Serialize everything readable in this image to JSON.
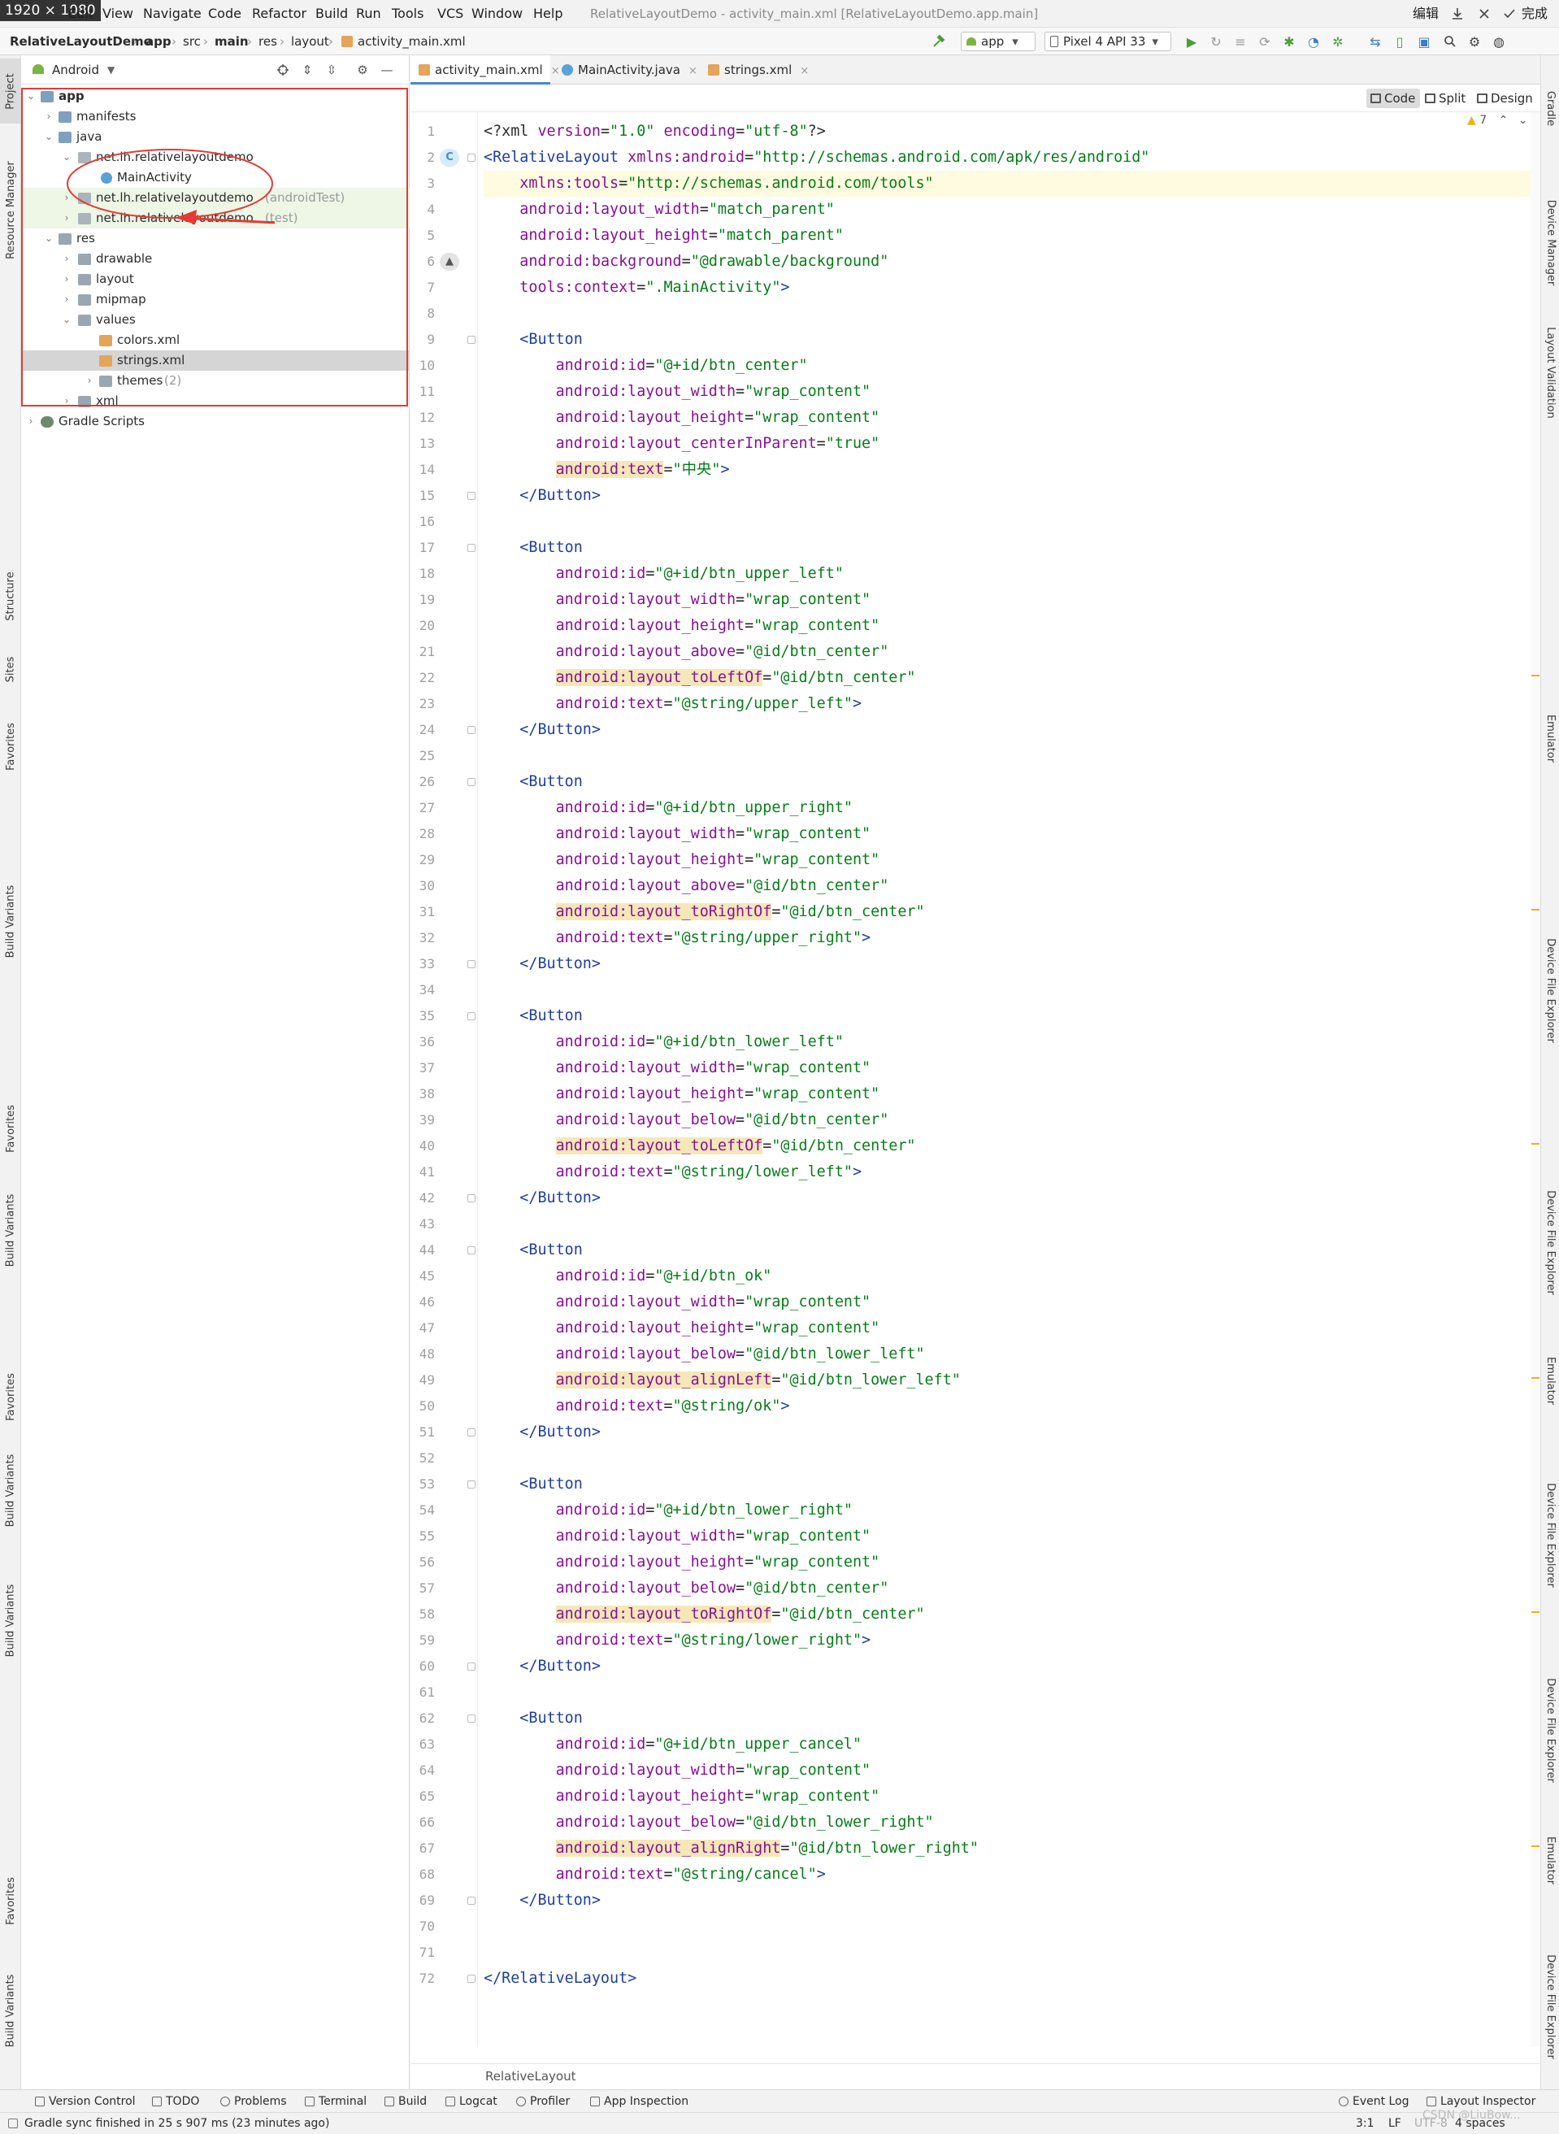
{
  "screen_badge": "1920 × 1080",
  "window": {
    "title": "RelativeLayoutDemo - activity_main.xml [RelativeLayoutDemo.app.main]",
    "ime_labels": [
      "编辑",
      "完成"
    ]
  },
  "menu": [
    "Edit",
    "View",
    "Navigate",
    "Code",
    "Refactor",
    "Build",
    "Run",
    "Tools",
    "VCS",
    "Window",
    "Help"
  ],
  "nav": {
    "breadcrumbs": [
      "RelativeLayoutDemo",
      "app",
      "src",
      "main",
      "res",
      "layout",
      "activity_main.xml"
    ],
    "run_config": "app",
    "device": "Pixel 4 API 33"
  },
  "left_tabs": [
    "Project",
    "Resource Manager",
    "Structure",
    "Sites",
    "Favorites",
    "Build Variants",
    "Favorites",
    "Build Variants",
    "Favorites",
    "Build Variants",
    "Build Variants",
    "Favorites",
    "Build Variants"
  ],
  "project": {
    "view_mode": "Android",
    "tree": [
      {
        "label": "app",
        "suffix": ""
      },
      {
        "label": "manifests",
        "suffix": ""
      },
      {
        "label": "java",
        "suffix": ""
      },
      {
        "label": "net.lh.relativelayoutdemo",
        "suffix": ""
      },
      {
        "label": "MainActivity",
        "suffix": ""
      },
      {
        "label": "net.lh.relativelayoutdemo",
        "suffix": "(androidTest)"
      },
      {
        "label": "net.lh.relativelayoutdemo",
        "suffix": "(test)"
      },
      {
        "label": "res",
        "suffix": ""
      },
      {
        "label": "drawable",
        "suffix": ""
      },
      {
        "label": "layout",
        "suffix": ""
      },
      {
        "label": "mipmap",
        "suffix": ""
      },
      {
        "label": "values",
        "suffix": ""
      },
      {
        "label": "colors.xml",
        "suffix": ""
      },
      {
        "label": "strings.xml",
        "suffix": ""
      },
      {
        "label": "themes",
        "suffix": "(2)"
      },
      {
        "label": "xml",
        "suffix": ""
      },
      {
        "label": "Gradle Scripts",
        "suffix": ""
      }
    ]
  },
  "editor": {
    "tabs": [
      "activity_main.xml",
      "MainActivity.java",
      "strings.xml"
    ],
    "view_modes": [
      "Code",
      "Split",
      "Design"
    ],
    "warnings": "7",
    "footer_crumb": "RelativeLayout",
    "lines": [
      "<?xml version=\"1.0\" encoding=\"utf-8\"?>",
      "<RelativeLayout xmlns:android=\"http://schemas.android.com/apk/res/android\"",
      "    xmlns:tools=\"http://schemas.android.com/tools\"",
      "    android:layout_width=\"match_parent\"",
      "    android:layout_height=\"match_parent\"",
      "    android:background=\"@drawable/background\"",
      "    tools:context=\".MainActivity\">",
      "",
      "    <Button",
      "        android:id=\"@+id/btn_center\"",
      "        android:layout_width=\"wrap_content\"",
      "        android:layout_height=\"wrap_content\"",
      "        android:layout_centerInParent=\"true\"",
      "        android:text=\"中央\">",
      "    </Button>",
      "",
      "    <Button",
      "        android:id=\"@+id/btn_upper_left\"",
      "        android:layout_width=\"wrap_content\"",
      "        android:layout_height=\"wrap_content\"",
      "        android:layout_above=\"@id/btn_center\"",
      "        android:layout_toLeftOf=\"@id/btn_center\"",
      "        android:text=\"@string/upper_left\">",
      "    </Button>",
      "",
      "    <Button",
      "        android:id=\"@+id/btn_upper_right\"",
      "        android:layout_width=\"wrap_content\"",
      "        android:layout_height=\"wrap_content\"",
      "        android:layout_above=\"@id/btn_center\"",
      "        android:layout_toRightOf=\"@id/btn_center\"",
      "        android:text=\"@string/upper_right\">",
      "    </Button>",
      "",
      "    <Button",
      "        android:id=\"@+id/btn_lower_left\"",
      "        android:layout_width=\"wrap_content\"",
      "        android:layout_height=\"wrap_content\"",
      "        android:layout_below=\"@id/btn_center\"",
      "        android:layout_toLeftOf=\"@id/btn_center\"",
      "        android:text=\"@string/lower_left\">",
      "    </Button>",
      "",
      "    <Button",
      "        android:id=\"@+id/btn_ok\"",
      "        android:layout_width=\"wrap_content\"",
      "        android:layout_height=\"wrap_content\"",
      "        android:layout_below=\"@id/btn_lower_left\"",
      "        android:layout_alignLeft=\"@id/btn_lower_left\"",
      "        android:text=\"@string/ok\">",
      "    </Button>",
      "",
      "    <Button",
      "        android:id=\"@+id/btn_lower_right\"",
      "        android:layout_width=\"wrap_content\"",
      "        android:layout_height=\"wrap_content\"",
      "        android:layout_below=\"@id/btn_center\"",
      "        android:layout_toRightOf=\"@id/btn_center\"",
      "        android:text=\"@string/lower_right\">",
      "    </Button>",
      "",
      "    <Button",
      "        android:id=\"@+id/btn_upper_cancel\"",
      "        android:layout_width=\"wrap_content\"",
      "        android:layout_height=\"wrap_content\"",
      "        android:layout_below=\"@id/btn_lower_right\"",
      "        android:layout_alignRight=\"@id/btn_lower_right\"",
      "        android:text=\"@string/cancel\">",
      "    </Button>",
      "",
      "",
      "</RelativeLayout>"
    ],
    "highlighted_lines": [
      14,
      22,
      31,
      40,
      49,
      58,
      67
    ]
  },
  "right_tabs": [
    "Gradle",
    "Device Manager",
    "Layout Validation",
    "Emulator",
    "Device File Explorer",
    "Device File Explorer",
    "Emulator",
    "Device File Explorer",
    "Device File Explorer",
    "Emulator",
    "Device File Explorer"
  ],
  "bottom_tools": [
    "Version Control",
    "TODO",
    "Problems",
    "Terminal",
    "Build",
    "Logcat",
    "Profiler",
    "App Inspection"
  ],
  "bottom_tools_right": [
    "Event Log",
    "Layout Inspector"
  ],
  "status": {
    "message": "Gradle sync finished in 25 s 907 ms (23 minutes ago)",
    "position": "3:1",
    "line_sep": "LF",
    "encoding": "UTF-8",
    "indent": "4 spaces",
    "watermark": "CSDN @LiuBow..."
  },
  "colors": {
    "tag": "#1f3e9e",
    "attr": "#871094",
    "value": "#067d17",
    "annotation": "#e53935",
    "highlight": "#f6e7b8"
  }
}
